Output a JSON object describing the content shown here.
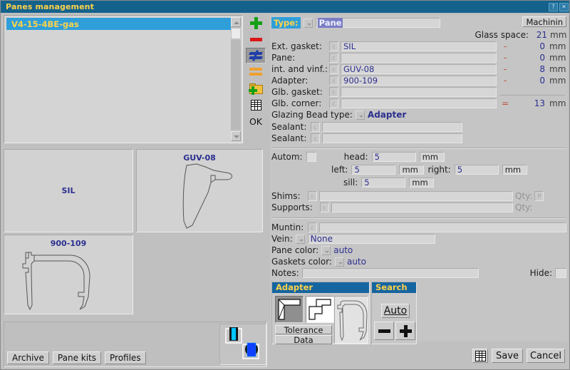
{
  "window": {
    "title": "Panes management",
    "help_button": "?",
    "close_button": "✕"
  },
  "list_panel": {
    "items": [
      {
        "label": "V4-15-4BE-gas",
        "selected": true
      }
    ],
    "scrollbar": {
      "up_arrow": "▲",
      "down_arrow": "▼"
    }
  },
  "icon_toolbar": [
    {
      "name": "add-icon",
      "tooltip": "Add"
    },
    {
      "name": "remove-icon",
      "tooltip": "Remove"
    },
    {
      "name": "not-equal-icon",
      "tooltip": "Different"
    },
    {
      "name": "equal-icon",
      "tooltip": "Equal"
    },
    {
      "name": "add-folder-icon",
      "tooltip": "Add folder"
    },
    {
      "name": "table-icon",
      "tooltip": "Table"
    },
    {
      "name": "ok-button",
      "label": "OK"
    }
  ],
  "previews": [
    {
      "caption": "SIL",
      "shape": "none"
    },
    {
      "caption": "GUV-08",
      "shape": "gasket"
    },
    {
      "caption": "900-109",
      "shape": "adapter"
    }
  ],
  "bottom_tabs": [
    {
      "label": "Archive",
      "accesskey": "A"
    },
    {
      "label": "Pane kits",
      "accesskey": "P"
    },
    {
      "label": "Profiles",
      "accesskey": "r"
    }
  ],
  "orientation_buttons": [
    {
      "name": "vertical-pane-icon"
    },
    {
      "name": "horizontal-pane-icon"
    }
  ],
  "form": {
    "type": {
      "label": "Type:",
      "value": "Pane"
    },
    "machining_button": "Machinin",
    "glass_space": {
      "label": "Glass space:",
      "value": "21",
      "unit": "mm"
    },
    "rows": [
      {
        "label": "Ext. gasket:",
        "value": "SIL",
        "op": "-",
        "amount": "0",
        "unit": "mm"
      },
      {
        "label": "Pane:",
        "value": "",
        "op": "-",
        "amount": "0",
        "unit": "mm"
      },
      {
        "label": "int. and vinf.:",
        "value": "GUV-08",
        "op": "-",
        "amount": "8",
        "unit": "mm"
      },
      {
        "label": "Adapter:",
        "value": "900-109",
        "op": "-",
        "amount": "0",
        "unit": "mm"
      },
      {
        "label": "Glb. gasket:",
        "value": "",
        "op": "",
        "amount": "",
        "unit": ""
      },
      {
        "label": "Glb. corner:",
        "value": "",
        "op": "=",
        "amount": "13",
        "unit": "mm"
      }
    ],
    "glazing_bead": {
      "label": "Glazing Bead type:",
      "value": "Adapter"
    },
    "sealant1": {
      "label": "Sealant:",
      "value": ""
    },
    "sealant2": {
      "label": "Sealant:",
      "value": ""
    },
    "autom": {
      "label": "Autom:",
      "checked": false
    },
    "head": {
      "label": "head:",
      "value": "5",
      "unit": "mm"
    },
    "left": {
      "label": "left:",
      "value": "5",
      "unit": "mm"
    },
    "right": {
      "label": "right:",
      "value": "5",
      "unit": "mm"
    },
    "sill": {
      "label": "sill:",
      "value": "5",
      "unit": "mm"
    },
    "shims": {
      "label": "Shims:",
      "value": "",
      "qty_label": "Qty:",
      "qty_value": "P"
    },
    "supports": {
      "label": "Supports:",
      "value": "",
      "qty_label": "Qty:",
      "qty_value": ""
    },
    "muntin": {
      "label": "Muntin:",
      "value": ""
    },
    "vein": {
      "label": "Vein:",
      "value": "None"
    },
    "pane_color": {
      "label": "Pane color:",
      "value": "auto"
    },
    "gaskets_color": {
      "label": "Gaskets color:",
      "value": "auto"
    },
    "notes": {
      "label": "Notes:",
      "value": ""
    },
    "hide": {
      "label": "Hide:",
      "checked": false
    }
  },
  "adapter_group": {
    "title": "Adapter",
    "tolerance_button": "Tolerance",
    "data_button": "Data",
    "swatch_selected_index": 0
  },
  "search_group": {
    "title": "Search",
    "auto_button": "Auto",
    "minus_button": "−",
    "plus_button": "+"
  },
  "footer": {
    "table_icon": "table-icon",
    "save_button": "Save",
    "cancel_button": "Cancel"
  },
  "colors": {
    "title_bar": "#14628c",
    "title_text": "#ffd24a",
    "selection": "#2f9fd9",
    "value_blue": "#2b2f8f",
    "accent_red": "#c24a3a",
    "group_header": "#1565a0",
    "window_bg": "#c0c0c0"
  }
}
